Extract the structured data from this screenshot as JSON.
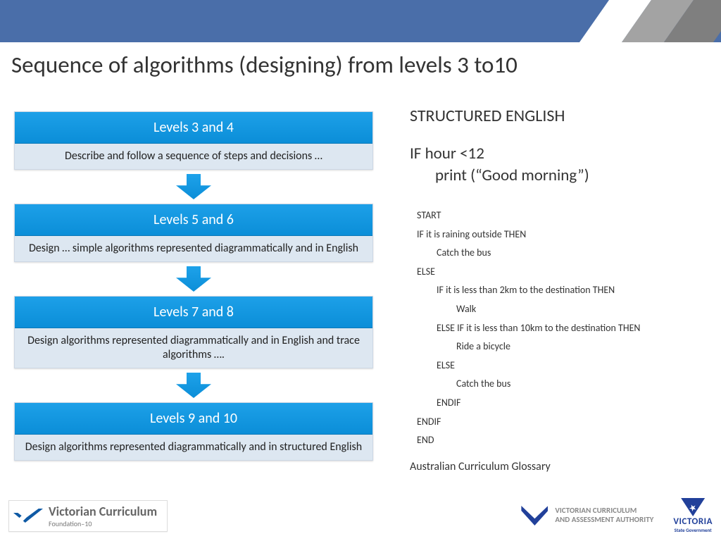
{
  "title": "Sequence of algorithms (designing) from levels 3 to10",
  "cards": {
    "l34": {
      "head": "Levels 3 and 4",
      "body": "Describe and follow a sequence of steps and decisions …"
    },
    "l56": {
      "head": "Levels 5 and 6",
      "body": "Design … simple algorithms represented diagrammatically and in English"
    },
    "l78": {
      "head": "Levels 7 and 8",
      "body": "Design algorithms represented diagrammatically and in English and trace algorithms …."
    },
    "l910": {
      "head": "Levels 9 and 10",
      "body": "Design algorithms represented diagrammatically and in structured English"
    }
  },
  "right": {
    "heading": "STRUCTURED ENGLISH",
    "example_line1": "IF hour <12",
    "example_line2": "print (“Good morning”)",
    "pseudo": {
      "l0a": "START",
      "l0b": "IF it is raining outside THEN",
      "l1a": "Catch the bus",
      "l0c": "ELSE",
      "l1b": "IF it is less than 2km to the destination THEN",
      "l2a": "Walk",
      "l1c": "ELSE IF it is less than 10km to the destination THEN",
      "l2b": "Ride a bicycle",
      "l1d": "ELSE",
      "l2c": "Catch the bus",
      "l1e": "ENDIF",
      "l0d": "ENDIF",
      "l0e": "END"
    },
    "glossary": "Australian Curriculum Glossary"
  },
  "footer": {
    "vc_line1": "Victorian Curriculum",
    "vc_line2": "Foundation–10",
    "vcaa_line1": "VICTORIAN CURRICULUM",
    "vcaa_line2": "AND ASSESSMENT AUTHORITY",
    "vic_line1": "VICTORIA",
    "vic_line2": "State Government"
  }
}
